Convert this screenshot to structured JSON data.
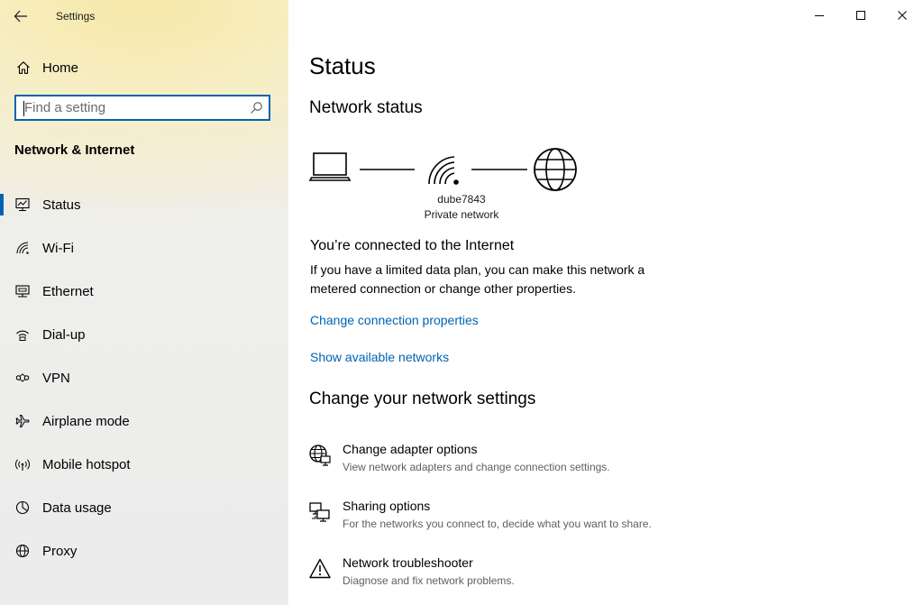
{
  "window": {
    "title": "Settings",
    "controls": [
      "minimize-icon",
      "maximize-icon",
      "close-icon"
    ]
  },
  "colors": {
    "accent": "#0063b1",
    "link": "#0063b1",
    "secondary_text": "#5f5f5f",
    "sidebar_bg": "#ececec"
  },
  "sidebar": {
    "home_label": "Home",
    "search_placeholder": "Find a setting",
    "section_title": "Network & Internet",
    "items": [
      {
        "label": "Status",
        "icon": "status-icon",
        "selected": true
      },
      {
        "label": "Wi-Fi",
        "icon": "wifi-icon"
      },
      {
        "label": "Ethernet",
        "icon": "ethernet-icon"
      },
      {
        "label": "Dial-up",
        "icon": "dialup-icon"
      },
      {
        "label": "VPN",
        "icon": "vpn-icon"
      },
      {
        "label": "Airplane mode",
        "icon": "airplane-icon"
      },
      {
        "label": "Mobile hotspot",
        "icon": "hotspot-icon"
      },
      {
        "label": "Data usage",
        "icon": "data-usage-icon"
      },
      {
        "label": "Proxy",
        "icon": "proxy-icon"
      }
    ]
  },
  "main": {
    "title": "Status",
    "network_status_heading": "Network status",
    "network": {
      "name": "dube7843",
      "type": "Private network"
    },
    "connected_title": "You’re connected to the Internet",
    "connected_desc": "If you have a limited data plan, you can make this network a metered connection or change other properties.",
    "links": {
      "change_properties": "Change connection properties",
      "show_networks": "Show available networks"
    },
    "change_settings_heading": "Change your network settings",
    "settings": [
      {
        "title": "Change adapter options",
        "desc": "View network adapters and change connection settings.",
        "icon": "adapter-globe-icon"
      },
      {
        "title": "Sharing options",
        "desc": "For the networks you connect to, decide what you want to share.",
        "icon": "sharing-icon"
      },
      {
        "title": "Network troubleshooter",
        "desc": "Diagnose and fix network problems.",
        "icon": "warning-icon"
      }
    ]
  }
}
